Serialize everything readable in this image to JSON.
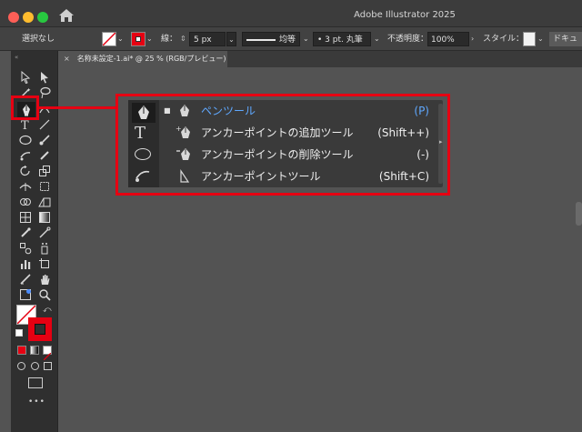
{
  "window": {
    "title": "Adobe Illustrator 2025"
  },
  "control_bar": {
    "selection_label": "選択なし",
    "stroke_label": "線：",
    "stroke_weight": "5 px",
    "profile_label": "均等",
    "brush_label": "3 pt. 丸筆",
    "opacity_label": "不透明度：",
    "opacity_value": "100%",
    "style_label": "スタイル：",
    "doc_label": "ドキュ"
  },
  "document_tab": {
    "close": "×",
    "title": "名称未設定-1.ai* @ 25 % (RGB/プレビュー)"
  },
  "flyout": {
    "items": [
      {
        "label": "ペンツール",
        "shortcut": "(P)",
        "icon": "pen-icon",
        "active": true,
        "check": "■"
      },
      {
        "label": "アンカーポイントの追加ツール",
        "shortcut": "(Shift++)",
        "icon": "add-anchor-point-icon"
      },
      {
        "label": "アンカーポイントの削除ツール",
        "shortcut": "(-)",
        "icon": "delete-anchor-point-icon"
      },
      {
        "label": "アンカーポイントツール",
        "shortcut": "(Shift+C)",
        "icon": "anchor-point-icon"
      }
    ]
  },
  "toolbar": {
    "more": "•••",
    "grip": "«"
  },
  "colors": {
    "highlight": "#e60012",
    "active_item": "#5fa8ff",
    "panel_bg": "#3a3a3a",
    "canvas": "#535353"
  }
}
